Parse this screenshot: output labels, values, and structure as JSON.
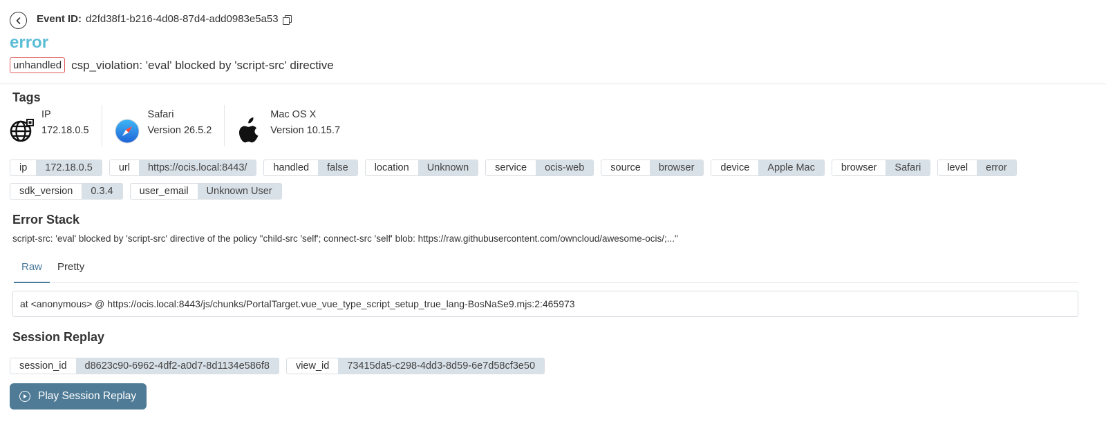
{
  "header": {
    "event_id_label": "Event ID:",
    "event_id": "d2fd38f1-b216-4d08-87d4-add0983e5a53",
    "level": "error",
    "badge": "unhandled",
    "message": "csp_violation: 'eval' blocked by 'script-src' directive"
  },
  "tags_section": {
    "title": "Tags",
    "cards": [
      {
        "icon": "globe-network-icon",
        "title": "IP",
        "value": "172.18.0.5"
      },
      {
        "icon": "safari-icon",
        "title": "Safari",
        "value": "Version 26.5.2"
      },
      {
        "icon": "apple-icon",
        "title": "Mac OS X",
        "value": "Version 10.15.7"
      }
    ],
    "pills": [
      {
        "key": "ip",
        "value": "172.18.0.5"
      },
      {
        "key": "url",
        "value": "https://ocis.local:8443/"
      },
      {
        "key": "handled",
        "value": "false"
      },
      {
        "key": "location",
        "value": "Unknown"
      },
      {
        "key": "service",
        "value": "ocis-web"
      },
      {
        "key": "source",
        "value": "browser"
      },
      {
        "key": "device",
        "value": "Apple Mac"
      },
      {
        "key": "browser",
        "value": "Safari"
      },
      {
        "key": "level",
        "value": "error"
      },
      {
        "key": "sdk_version",
        "value": "0.3.4"
      },
      {
        "key": "user_email",
        "value": "Unknown User"
      }
    ]
  },
  "error_stack": {
    "title": "Error Stack",
    "summary": "script-src: 'eval' blocked by 'script-src' directive of the policy \"child-src 'self'; connect-src 'self' blob: https://raw.githubusercontent.com/owncloud/awesome-ocis/;...\"",
    "tabs": [
      "Raw",
      "Pretty"
    ],
    "active_tab": "Raw",
    "raw": "at <anonymous> @ https://ocis.local:8443/js/chunks/PortalTarget.vue_vue_type_script_setup_true_lang-BosNaSe9.mjs:2:465973"
  },
  "session_replay": {
    "title": "Session Replay",
    "pills": [
      {
        "key": "session_id",
        "value": "d8623c90-6962-4df2-a0d7-8d1134e586f8"
      },
      {
        "key": "view_id",
        "value": "73415da5-c298-4dd3-8d59-6e7d58cf3e50"
      }
    ],
    "button_label": "Play Session Replay",
    "button_color": "#4f7b96"
  },
  "colors": {
    "level": "#5bbcd6",
    "badge_border": "#e05a5a",
    "pill_value_bg": "#d9e1e8",
    "active_tab": "#4a7a9c"
  }
}
